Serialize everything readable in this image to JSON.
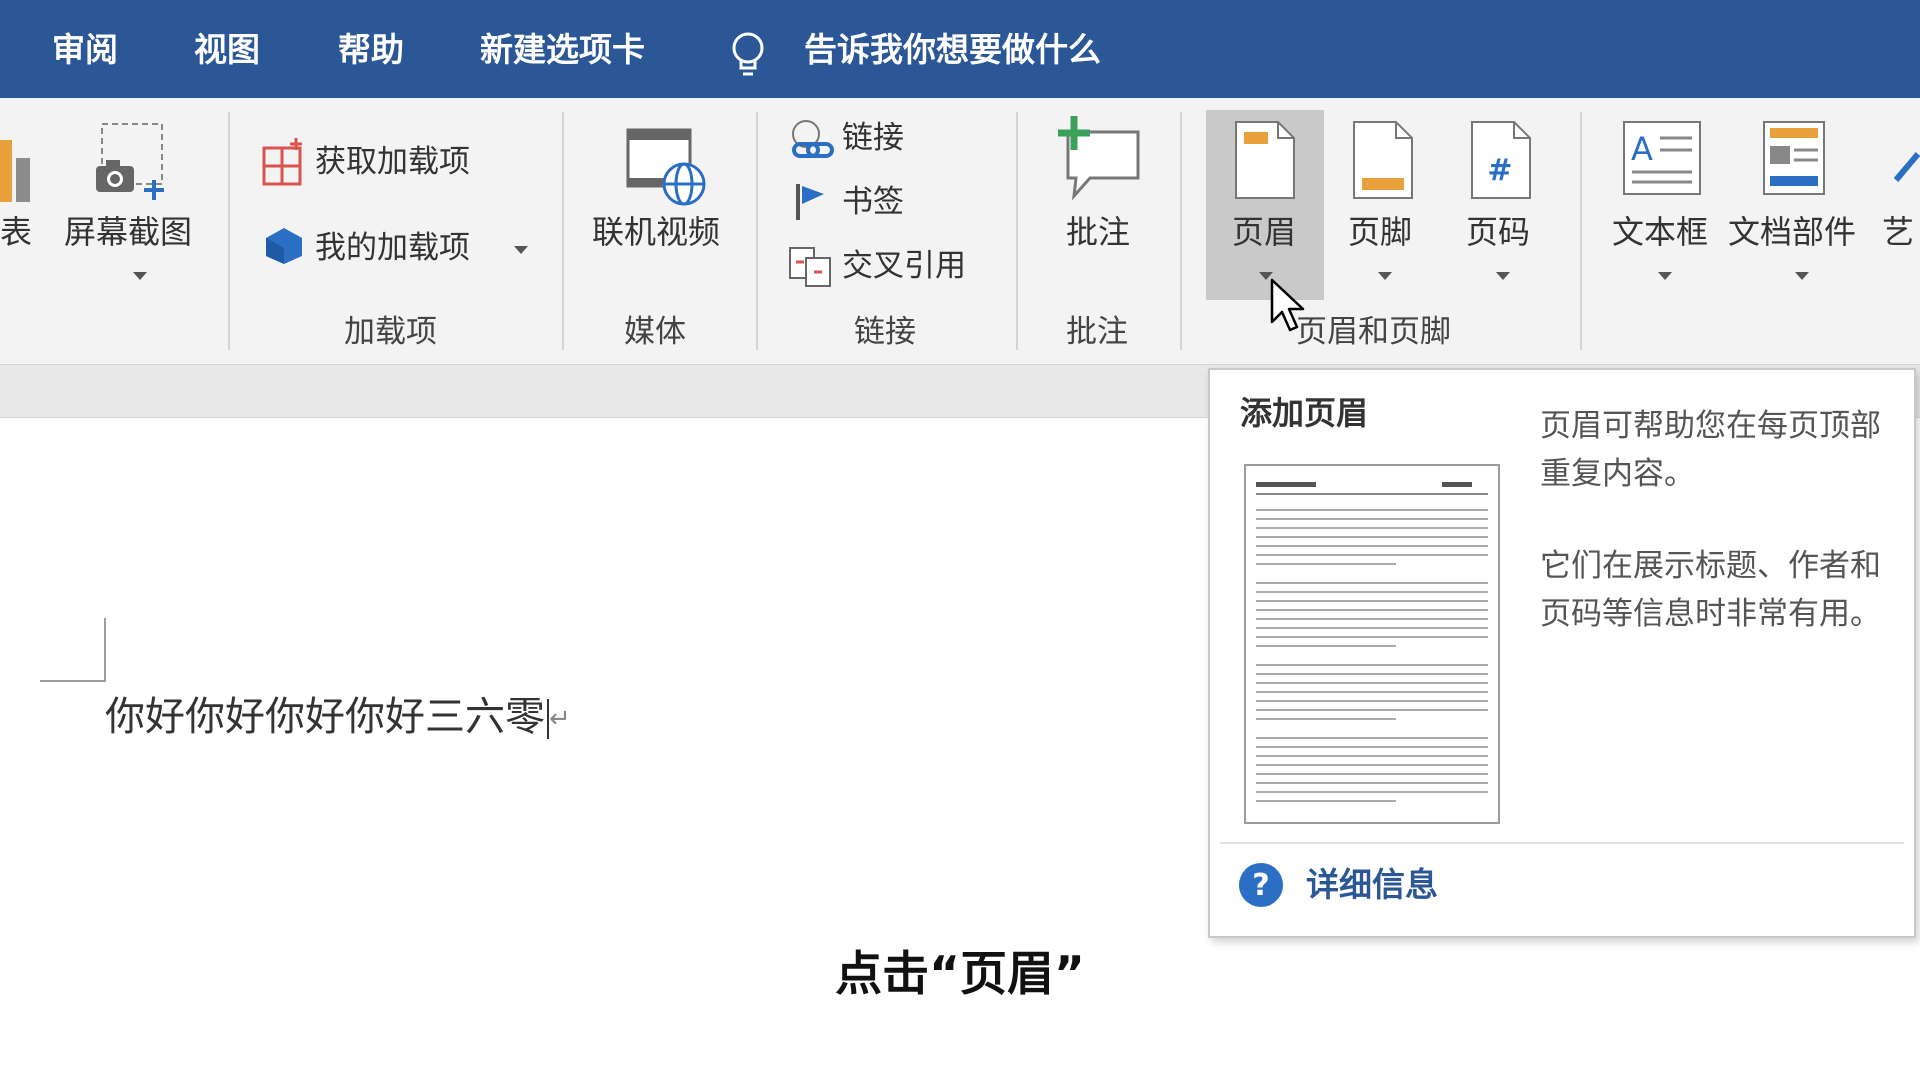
{
  "tabs": [
    "审阅",
    "视图",
    "帮助",
    "新建选项卡"
  ],
  "tell_me": {
    "icon": "lightbulb-icon",
    "text": "告诉我你想要做什么"
  },
  "ribbon": {
    "partial_left_label": "表",
    "screenshot": {
      "label": "屏幕截图",
      "icon": "screenshot-icon"
    },
    "addins": {
      "get_addins": "获取加载项",
      "my_addins": "我的加载项",
      "group": "加载项"
    },
    "media": {
      "online_video": "联机视频",
      "group": "媒体"
    },
    "links": {
      "link": "链接",
      "bookmark": "书签",
      "cross_reference": "交叉引用",
      "group": "链接"
    },
    "comments": {
      "comment": "批注",
      "group": "批注"
    },
    "header_footer": {
      "header": "页眉",
      "footer": "页脚",
      "page_number": "页码",
      "page_number_glyph": "#",
      "group": "页眉和页脚"
    },
    "text": {
      "text_box": "文本框",
      "quick_parts": "文档部件",
      "wordart_partial": "艺"
    }
  },
  "document": {
    "text": "你好你好你好你好三六零"
  },
  "tooltip": {
    "title": "添加页眉",
    "desc1": "页眉可帮助您在每页顶部重复内容。",
    "desc2": "它们在展示标题、作者和页码等信息时非常有用。",
    "link": "详细信息",
    "link_icon": "help-circle-icon"
  },
  "subtitle": "点击“页眉”",
  "colors": {
    "title_bar": "#2b5797",
    "ribbon_bg": "#f3f3f3",
    "accent_orange": "#e8a13a",
    "link_blue": "#2b5797",
    "plus_green": "#3aa05a"
  }
}
